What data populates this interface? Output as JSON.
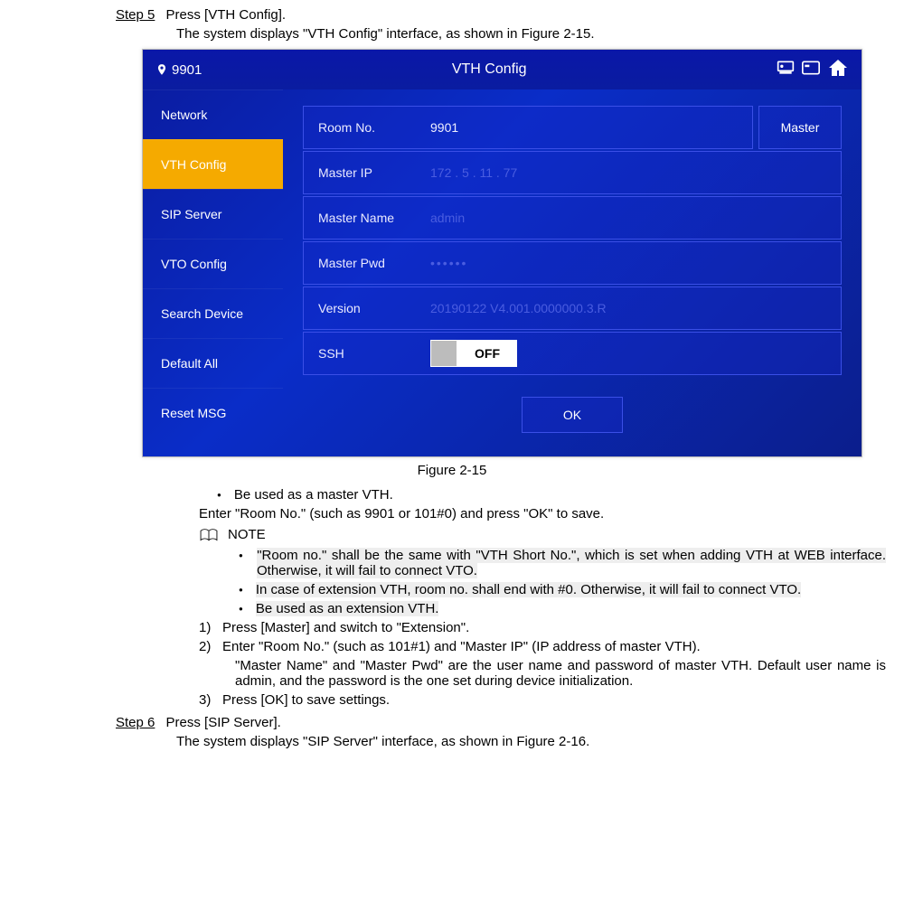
{
  "step5": {
    "label": "Step 5",
    "text": "Press [VTH Config].",
    "text2": "The system displays \"VTH Config\" interface, as shown in Figure 2-15."
  },
  "device": {
    "titlebar": {
      "room": "9901",
      "title": "VTH Config"
    },
    "sidebar": [
      "Network",
      "VTH Config",
      "SIP Server",
      "VTO Config",
      "Search Device",
      "Default All",
      "Reset MSG"
    ],
    "rows": {
      "roomno_label": "Room No.",
      "roomno_value": "9901",
      "master_btn": "Master",
      "masterip_label": "Master IP",
      "masterip_value": "172   .   5    .   11   .   77",
      "mastername_label": "Master Name",
      "mastername_value": "admin",
      "masterpwd_label": "Master Pwd",
      "masterpwd_value": "••••••",
      "version_label": "Version",
      "version_value": "20190122 V4.001.0000000.3.R",
      "ssh_label": "SSH",
      "ssh_toggle": "OFF"
    },
    "ok": "OK"
  },
  "figure": "Figure 2-15",
  "body": {
    "b1": "Be used as a master VTH.",
    "p1": "Enter \"Room No.\" (such as 9901 or 101#0) and press \"OK\" to save.",
    "note_label": "NOTE",
    "nb1": "\"Room no.\" shall be the same with \"VTH Short No.\", which is set when adding VTH at WEB interface. Otherwise, it will fail to connect VTO.",
    "nb2": "In case of extension VTH, room no. shall end with #0. Otherwise, it will fail to connect VTO.",
    "nb3": "Be used as an extension VTH.",
    "s1": "Press [Master] and switch to \"Extension\".",
    "s2": "Enter \"Room No.\" (such as 101#1) and \"Master IP\" (IP address of master VTH).",
    "s2b": "\"Master Name\" and \"Master Pwd\" are the user name and password of master VTH. Default user name is admin, and the password is the one set during device initialization.",
    "s3": "Press [OK] to save settings."
  },
  "step6": {
    "label": "Step 6",
    "text": "Press [SIP Server].",
    "text2": "The system displays \"SIP Server\" interface, as shown in Figure 2-16."
  }
}
